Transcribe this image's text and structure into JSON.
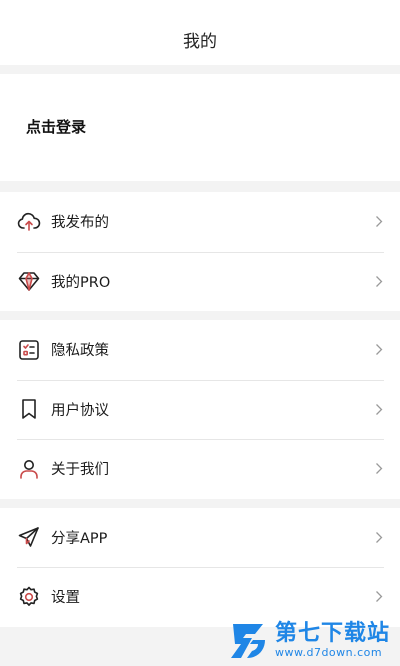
{
  "header": {
    "title": "我的"
  },
  "login": {
    "label": "点击登录"
  },
  "groups": [
    {
      "items": [
        {
          "label": "我发布的",
          "icon": "cloud-upload-icon"
        },
        {
          "label": "我的PRO",
          "icon": "diamond-icon"
        }
      ]
    },
    {
      "items": [
        {
          "label": "隐私政策",
          "icon": "checklist-icon"
        },
        {
          "label": "用户协议",
          "icon": "bookmark-icon"
        },
        {
          "label": "关于我们",
          "icon": "user-icon"
        }
      ]
    },
    {
      "items": [
        {
          "label": "分享APP",
          "icon": "paper-plane-icon"
        },
        {
          "label": "设置",
          "icon": "gear-icon"
        }
      ]
    }
  ],
  "watermark": {
    "name": "第七下载站",
    "url": "www.d7down.com"
  },
  "colors": {
    "icon_stroke": "#222222",
    "icon_accent": "#c94b4b",
    "watermark": "#1f86e6",
    "chevron": "#9a9a9a"
  }
}
